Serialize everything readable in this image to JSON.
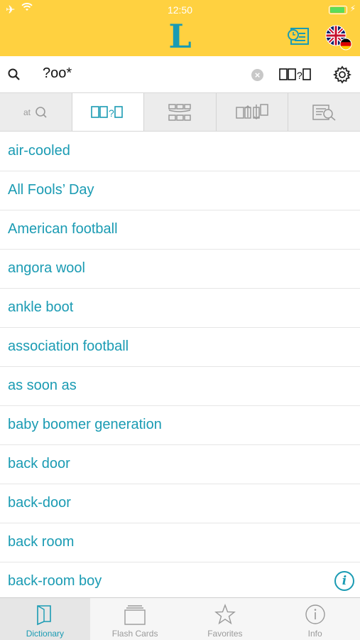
{
  "status_bar": {
    "time": "12:50",
    "airplane_icon": "✈",
    "wifi_icon": "wifi",
    "bolt_icon": "⚡"
  },
  "header": {
    "logo": "L",
    "history_icon": "history-icon",
    "language_icon": "flag-uk-de-icon"
  },
  "search": {
    "query": "?oo*",
    "clear_icon": "×",
    "wildcard_label": "?",
    "settings_icon": "gear-icon"
  },
  "modes": [
    {
      "name": "text-search",
      "glyph": "at"
    },
    {
      "name": "wildcard-search",
      "glyph": "?",
      "active": true
    },
    {
      "name": "crossword-search",
      "glyph": "▦"
    },
    {
      "name": "anagram-search",
      "glyph": "⇅"
    },
    {
      "name": "fulltext-search",
      "glyph": "☰"
    }
  ],
  "results": [
    "air-cooled",
    "All Fools’ Day",
    "American football",
    "angora wool",
    "ankle boot",
    "association football",
    "as soon as",
    "baby boomer generation",
    "back door",
    "back-door",
    "back room",
    "back-room boy"
  ],
  "info_icon": "i",
  "tabs": [
    {
      "label": "Dictionary",
      "active": true
    },
    {
      "label": "Flash Cards"
    },
    {
      "label": "Favorites"
    },
    {
      "label": "Info"
    }
  ],
  "colors": {
    "accent": "#1a9bb3",
    "header": "#FFD140"
  }
}
